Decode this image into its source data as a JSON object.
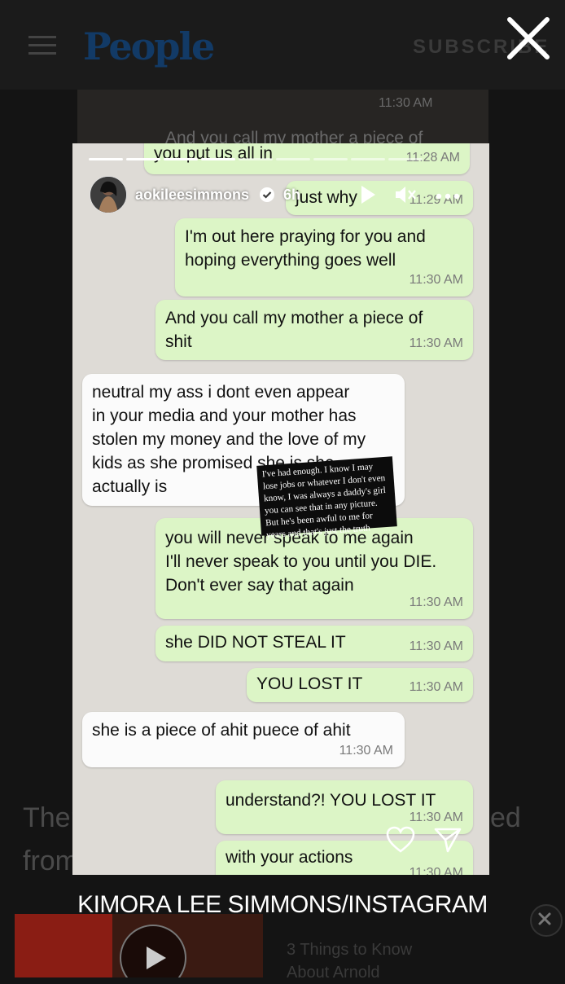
{
  "site": {
    "logo": "People",
    "subscribe": "SUBSCRIBE"
  },
  "background_text": {
    "left_word_1": "Ther",
    "right_word_1": "ed",
    "left_word_2": "from"
  },
  "story": {
    "username": "aokileesimmons",
    "age_label": "6h",
    "progress_segments": 12,
    "progress_done": 4,
    "partial_top_bubbles": [
      {
        "text": "",
        "time": "11:30 AM"
      },
      {
        "text": "And you call my mother a piece of\nyou put us all in",
        "time": "11:28 AM"
      },
      {
        "text": "just why",
        "time": "11:29 AM"
      }
    ],
    "messages": [
      {
        "dir": "out",
        "text": "I'm out here praying for you and\nhoping everything goes well",
        "time": "11:30 AM"
      },
      {
        "dir": "out",
        "text": "And you call my mother a piece of\nshit",
        "time": "11:30 AM"
      },
      {
        "dir": "in",
        "text": "neutral my ass i  dont  even appear\nin your media and your mother has\nstolen my money and the love of my\nkids as she promised  she is   she\nactually is",
        "time": ""
      },
      {
        "dir": "out",
        "text": "you will never speak to me again\nI'll never speak to you until you DIE.\nDon't ever say that again",
        "time": "11:30 AM"
      },
      {
        "dir": "out",
        "text": "she DID NOT STEAL IT",
        "time": "11:30 AM"
      },
      {
        "dir": "out",
        "text": "YOU LOST IT",
        "time": "11:30 AM"
      },
      {
        "dir": "in",
        "text": "she is a piece of ahit puece of ahit",
        "time": "11:30 AM"
      },
      {
        "dir": "out",
        "text": "understand?! YOU LOST IT",
        "time": "11:30 AM"
      },
      {
        "dir": "out",
        "text": "with your actions",
        "time": "11:30 AM"
      }
    ],
    "overlay_text": "I've had enough. I know I may lose jobs or whatever I don't even know, I was always a daddy's girl you can see that in any picture. But he's been awful to me for years and that's just the truth"
  },
  "caption": "KIMORA LEE SIMMONS/INSTAGRAM",
  "ad": {
    "title_line_1": "3 Things to Know",
    "title_line_2": "About Arnold"
  },
  "icons": [
    "menu-icon",
    "close-icon",
    "verified-badge-icon",
    "play-icon",
    "mute-icon",
    "more-icon",
    "heart-icon",
    "send-icon",
    "ad-close-icon",
    "ad-play-icon"
  ]
}
